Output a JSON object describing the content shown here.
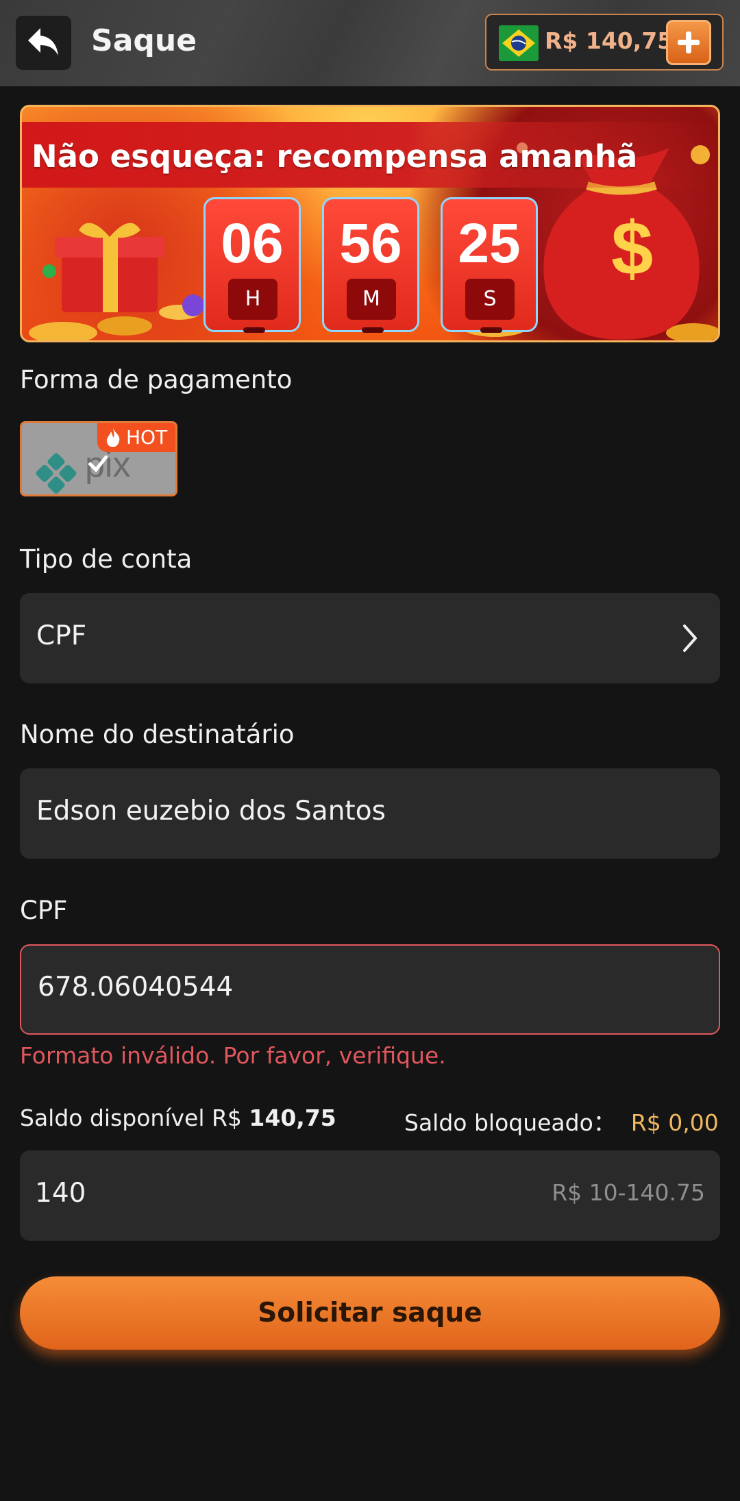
{
  "header": {
    "title": "Saque",
    "balance": "R$ 140,75"
  },
  "banner": {
    "text": "Não esqueça: recompensa amanhã",
    "timer": [
      {
        "value": "06",
        "unit": "H"
      },
      {
        "value": "56",
        "unit": "M"
      },
      {
        "value": "25",
        "unit": "S"
      }
    ]
  },
  "payment": {
    "label": "Forma de pagamento",
    "method_badge": "HOT",
    "method_logo_text": "pix"
  },
  "account_type": {
    "label": "Tipo de conta",
    "value": "CPF"
  },
  "recipient": {
    "label": "Nome do destinatário",
    "value": "Edson euzebio dos Santos"
  },
  "cpf": {
    "label": "CPF",
    "value": "678.06040544",
    "error": "Formato inválido. Por favor, verifique."
  },
  "saldo": {
    "available_label": "Saldo disponível R$",
    "available_value": "140,75",
    "blocked_label": "Saldo bloqueado：",
    "blocked_value": "R$ 0,00"
  },
  "amount": {
    "value": "140",
    "range": "R$ 10-140.75"
  },
  "submit_label": "Solicitar saque",
  "colors": {
    "accent": "#e97a2c",
    "error": "#e0575d",
    "blocked": "#f0b860",
    "background": "#141414",
    "field": "#2a2a2b"
  }
}
